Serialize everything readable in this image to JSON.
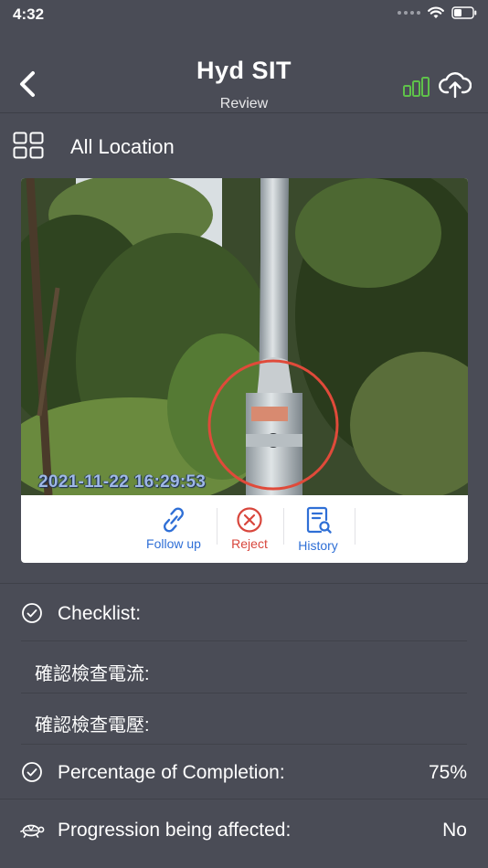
{
  "status": {
    "time": "4:32"
  },
  "nav": {
    "title": "Hyd SIT",
    "subtitle": "Review"
  },
  "location": {
    "label": "All Location"
  },
  "photo": {
    "timestamp": "2021-11-22 16:29:53"
  },
  "actions": [
    {
      "label": "Follow up",
      "color": "#2f6fd6",
      "icon": "link-icon"
    },
    {
      "label": "Reject",
      "color": "#d8463c",
      "icon": "x-circle-icon"
    },
    {
      "label": "History",
      "color": "#2f6fd6",
      "icon": "document-search-icon"
    }
  ],
  "checklist": {
    "title": "Checklist:",
    "items": [
      "確認檢查電流:",
      "確認檢查電壓:"
    ]
  },
  "completion": {
    "label": "Percentage of Completion:",
    "value": "75%"
  },
  "progression": {
    "label": "Progression being affected:",
    "value": "No"
  },
  "colors": {
    "background": "#4a4c56",
    "signal": "#5fc24a",
    "accent_blue": "#2f6fd6",
    "accent_red": "#d8463c"
  }
}
